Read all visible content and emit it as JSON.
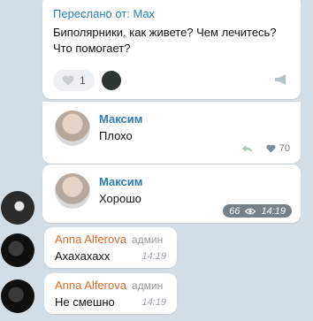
{
  "post": {
    "forward_header": "Переслано от: Max",
    "text": "Биполярники, как живете? Чем лечитесь? Что помогает?",
    "like_count": "1"
  },
  "comments": [
    {
      "name": "Максим",
      "text": "Плохо",
      "likes": "70"
    },
    {
      "name": "Максим",
      "text": "Хорошо",
      "views": "66",
      "time": "14:19"
    }
  ],
  "messages": [
    {
      "name": "Anna Alferova",
      "role": "админ",
      "text": "Ахахахахх",
      "time": "14:19"
    },
    {
      "name": "Anna Alferova",
      "role": "админ",
      "text": "Не смешно",
      "time": "14:19"
    }
  ],
  "colors": {
    "link_blue": "#2b7dbc",
    "admin_orange": "#e06a2c",
    "chat_bg": "#d3dde5"
  },
  "icons": [
    "heart-icon",
    "share-icon",
    "megaphone-icon",
    "eye-icon",
    "reply-icon"
  ]
}
